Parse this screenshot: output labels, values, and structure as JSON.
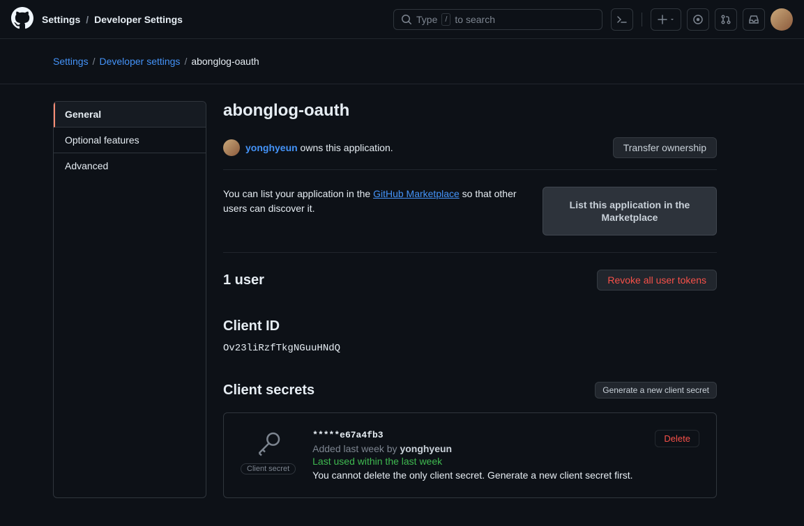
{
  "header": {
    "title_primary": "Settings",
    "title_secondary": "Developer Settings",
    "search_placeholder_pre": "Type",
    "search_kbd": "/",
    "search_placeholder_post": "to search"
  },
  "breadcrumbs": {
    "items": [
      {
        "label": "Settings",
        "link": true
      },
      {
        "label": "Developer settings",
        "link": true
      },
      {
        "label": "abonglog-oauth",
        "link": false
      }
    ]
  },
  "sidenav": {
    "items": [
      {
        "label": "General",
        "active": true
      },
      {
        "label": "Optional features",
        "active": false
      },
      {
        "label": "Advanced",
        "active": false
      }
    ]
  },
  "main": {
    "app_title": "abonglog-oauth",
    "owner_name": "yonghyeun",
    "owner_suffix": " owns this application.",
    "transfer_label": "Transfer ownership",
    "marketplace_text_pre": "You can list your application in the ",
    "marketplace_link": "GitHub Marketplace",
    "marketplace_text_post": " so that other users can discover it.",
    "marketplace_btn": "List this application in the Marketplace",
    "users_label": "1 user",
    "revoke_label": "Revoke all user tokens",
    "client_id_heading": "Client ID",
    "client_id_value": "Ov23liRzfTkgNGuuHNdQ",
    "secrets_heading": "Client secrets",
    "generate_secret_label": "Generate a new client secret",
    "secret": {
      "badge": "Client secret",
      "hash": "*****e67a4fb3",
      "added_pre": "Added last week by ",
      "added_by": "yonghyeun",
      "last_used": "Last used within the last week",
      "warn": "You cannot delete the only client secret. Generate a new client secret first.",
      "delete_label": "Delete"
    }
  }
}
